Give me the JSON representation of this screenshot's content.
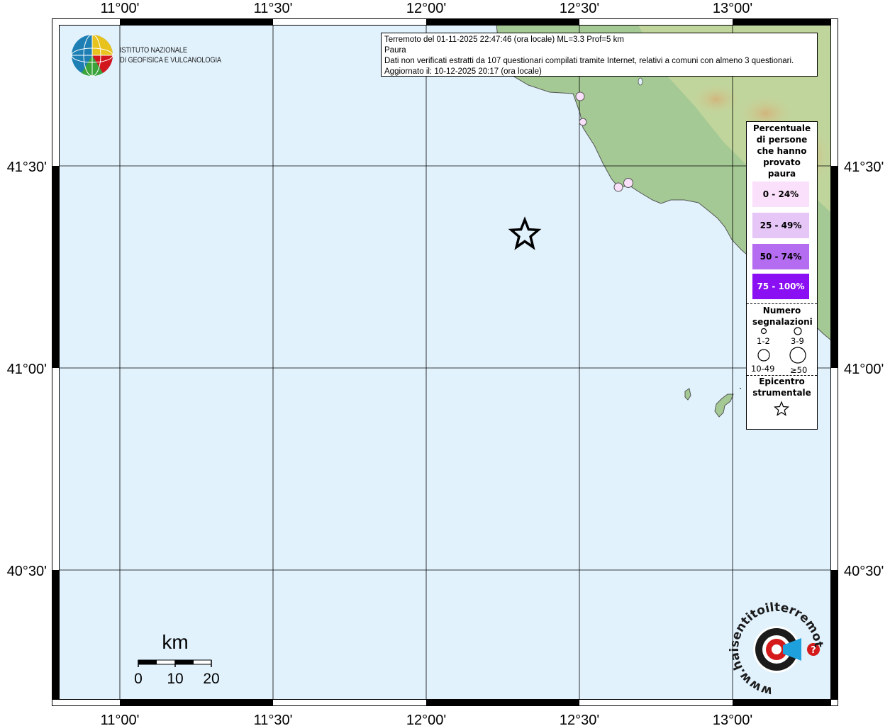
{
  "map": {
    "lon_ticks": [
      "11°00'",
      "11°30'",
      "12°00'",
      "12°30'",
      "13°00'"
    ],
    "lat_ticks": [
      "41°30'",
      "41°00'",
      "40°30'"
    ],
    "colors": {
      "sea": "#e1f2fd",
      "land_low": "#9dc58e",
      "land_mid": "#c9d49a",
      "land_high": "#d2b57d",
      "frame": "#000000"
    }
  },
  "info": {
    "line1": "Terremoto del 01-11-2025 22:47:46 (ora locale) ML=3.3 Prof=5 km",
    "line2": "Paura",
    "line3": "Dati non verificati estratti da 107 questionari compilati tramite Internet, relativi a comuni con almeno 3 questionari.",
    "line4": "Aggiornato il: 10-12-2025 20:17 (ora locale)"
  },
  "institute": {
    "line1": "ISTITUTO NAZIONALE",
    "line2": "DI GEOFISICA E VULCANOLOGIA"
  },
  "legend": {
    "title": "Percentuale di persone che hanno provato paura",
    "classes": [
      {
        "label": "0 - 24%",
        "color": "#fae0fa",
        "text_color": "#000000"
      },
      {
        "label": "25 - 49%",
        "color": "#e5c6f7",
        "text_color": "#000000"
      },
      {
        "label": "50 - 74%",
        "color": "#b46cf0",
        "text_color": "#000000"
      },
      {
        "label": "75 - 100%",
        "color": "#8a0ff2",
        "text_color": "#ffffff"
      }
    ],
    "count_title": "Numero segnalazioni",
    "sizes": [
      "1-2",
      "3-9",
      "10-49",
      "≥50"
    ],
    "epicenter_title": "Epicentro strumentale"
  },
  "scale": {
    "unit": "km",
    "labels": [
      "0",
      "10",
      "20"
    ]
  },
  "brand": {
    "text": "www.haisentitoilterremoto.it"
  }
}
